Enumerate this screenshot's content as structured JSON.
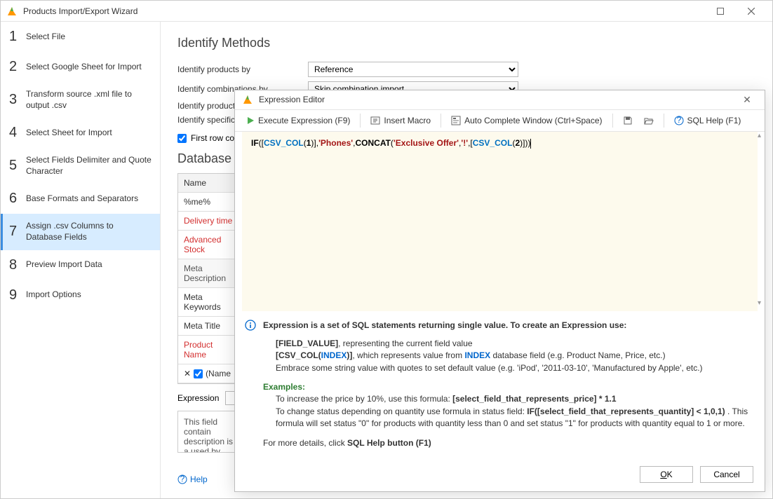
{
  "window": {
    "title": "Products Import/Export Wizard"
  },
  "steps": [
    {
      "num": "1",
      "label": "Select File"
    },
    {
      "num": "2",
      "label": "Select Google Sheet for Import"
    },
    {
      "num": "3",
      "label": "Transform source .xml file to output .csv"
    },
    {
      "num": "4",
      "label": "Select Sheet for Import"
    },
    {
      "num": "5",
      "label": "Select Fields Delimiter and Quote Character"
    },
    {
      "num": "6",
      "label": "Base Formats and Separators"
    },
    {
      "num": "7",
      "label": "Assign .csv Columns to Database Fields"
    },
    {
      "num": "8",
      "label": "Preview Import Data"
    },
    {
      "num": "9",
      "label": "Import Options"
    }
  ],
  "main": {
    "heading": "Identify Methods",
    "rows": [
      {
        "label": "Identify products by",
        "value": "Reference"
      },
      {
        "label": "Identify combinations by",
        "value": "Skip combination import"
      },
      {
        "label": "Identify product",
        "value": ""
      },
      {
        "label": "Identify specific",
        "value": ""
      }
    ],
    "firstRow": "First row con",
    "dbHeading": "Database F",
    "tableHeader": "Name",
    "filterRow": "%me%",
    "fields": [
      {
        "label": "Delivery time",
        "cls": "red"
      },
      {
        "label": "Advanced Stock",
        "cls": "red"
      },
      {
        "label": "Meta Description",
        "cls": "gray"
      },
      {
        "label": "Meta Keywords",
        "cls": ""
      },
      {
        "label": "Meta Title",
        "cls": ""
      },
      {
        "label": "Product Name",
        "cls": "red"
      }
    ],
    "nameCheckboxRow": "(Name",
    "exprLabel": "Expression",
    "note": "This field contain description is a used by search e",
    "helpLink": "Help"
  },
  "dialog": {
    "title": "Expression Editor",
    "toolbar": {
      "execute": "Execute Expression (F9)",
      "insertMacro": "Insert Macro",
      "autoComplete": "Auto Complete Window (Ctrl+Space)",
      "sqlHelp": "SQL Help (F1)"
    },
    "code": {
      "t1": "IF",
      "t2": "(",
      "t3": "[",
      "t4": "CSV_COL",
      "t5": "(",
      "t6": "1",
      "t7": ")",
      "t8": "]",
      "t9": ",",
      "t10": "'Phones'",
      "t11": ",",
      "t12": "CONCAT",
      "t13": "(",
      "t14": "'Exclusive Offer'",
      "t15": ",",
      "t16": "'!'",
      "t17": ",",
      "t18": "[",
      "t19": "CSV_COL",
      "t20": "(",
      "t21": "2",
      "t22": ")",
      "t23": "]",
      "t24": ")",
      "t25": ")"
    },
    "help": {
      "intro": "Expression is a set of SQL statements returning single value. To create an Expression use:",
      "l1a": "[FIELD_VALUE]",
      "l1b": ", representing the current field value",
      "l2a": "[CSV_COL(",
      "l2b": "INDEX",
      "l2c": ")]",
      "l2d": ", which represents value from ",
      "l2e": "INDEX",
      "l2f": " database field (e.g. Product Name, Price, etc.)",
      "l3": "Embrace some string value with quotes to set default value (e.g. 'iPod', '2011-03-10', 'Manufactured by Apple', etc.)",
      "examplesLabel": "Examples:",
      "e1a": "To increase the price by 10%, use this formula: ",
      "e1b": "[select_field_that_represents_price] * 1.1",
      "e2a": "To change status depending on quantity use formula in status field: ",
      "e2b": "IF([select_field_that_represents_quantity] < 1,0,1)",
      "e2c": " . This formula will set status \"0\" for products with quantity less than 0 and set status \"1\" for products with quantity equal to 1 or more.",
      "more1": "For more details, click ",
      "more2": "SQL Help button (F1)"
    },
    "ok": "OK",
    "cancel": "Cancel"
  }
}
